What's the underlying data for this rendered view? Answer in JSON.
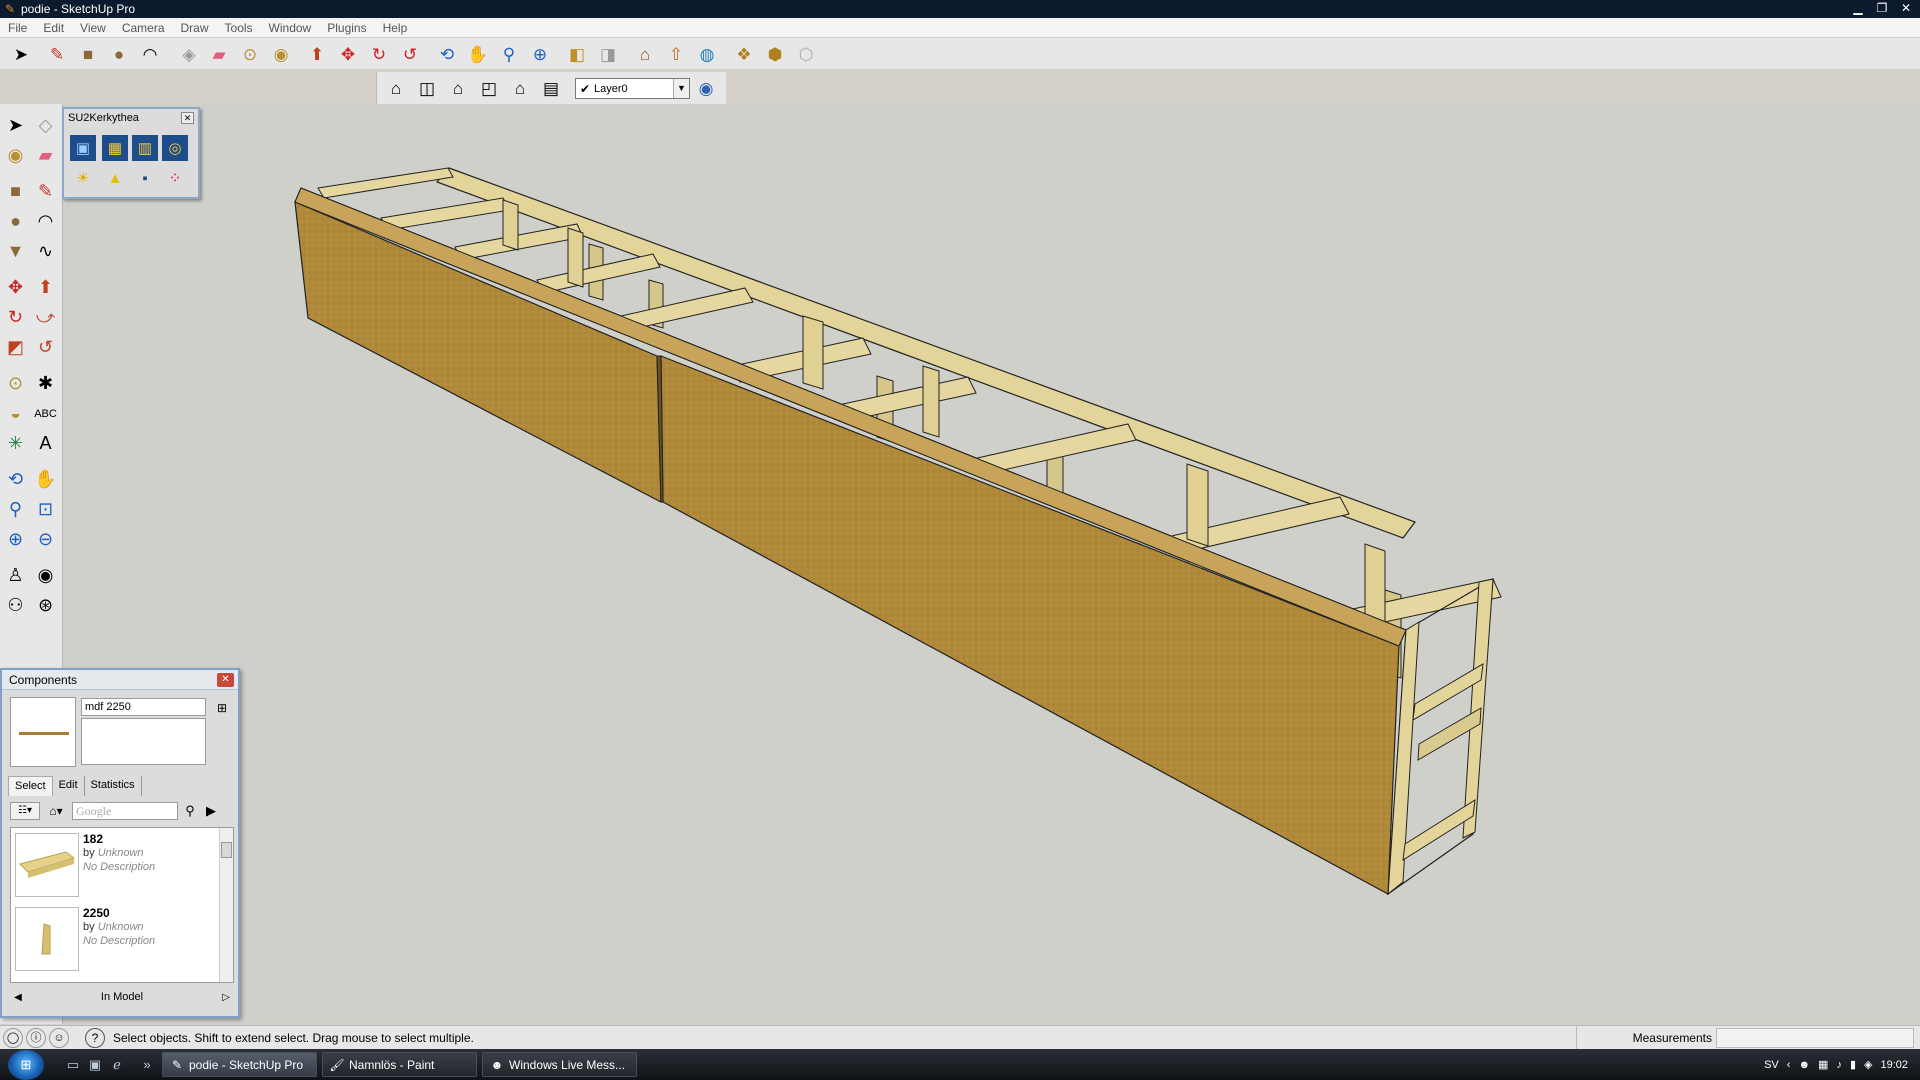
{
  "window": {
    "title": "podie - SketchUp Pro",
    "controls": [
      "minimize",
      "restore",
      "close"
    ]
  },
  "menu": [
    "File",
    "Edit",
    "View",
    "Camera",
    "Draw",
    "Tools",
    "Window",
    "Plugins",
    "Help"
  ],
  "toolbar": {
    "layer_value": "Layer0"
  },
  "kerkythea": {
    "title": "SU2Kerkythea"
  },
  "components": {
    "title": "Components",
    "name_value": "mdf 2250",
    "tabs": [
      "Select",
      "Edit",
      "Statistics"
    ],
    "search_placeholder": "Google",
    "items": [
      {
        "name": "182",
        "by_label": "by",
        "author": "Unknown",
        "description": "No Description"
      },
      {
        "name": "2250",
        "by_label": "by",
        "author": "Unknown",
        "description": "No Description"
      }
    ],
    "footer": "In Model"
  },
  "status": {
    "message": "Select objects. Shift to extend select. Drag mouse to select multiple.",
    "measurements_label": "Measurements"
  },
  "taskbar": {
    "tasks": [
      {
        "label": "podie - SketchUp Pro",
        "active": true
      },
      {
        "label": "Namnlös - Paint",
        "active": false
      },
      {
        "label": "Windows Live Mess...",
        "active": false
      }
    ],
    "language": "SV",
    "clock": "19:02"
  },
  "colors": {
    "titlebar": "#0c1a2e",
    "canvas": "#d0d0cb",
    "wood_board": "#b08a3a",
    "wood_frame": "#e3d49a"
  }
}
